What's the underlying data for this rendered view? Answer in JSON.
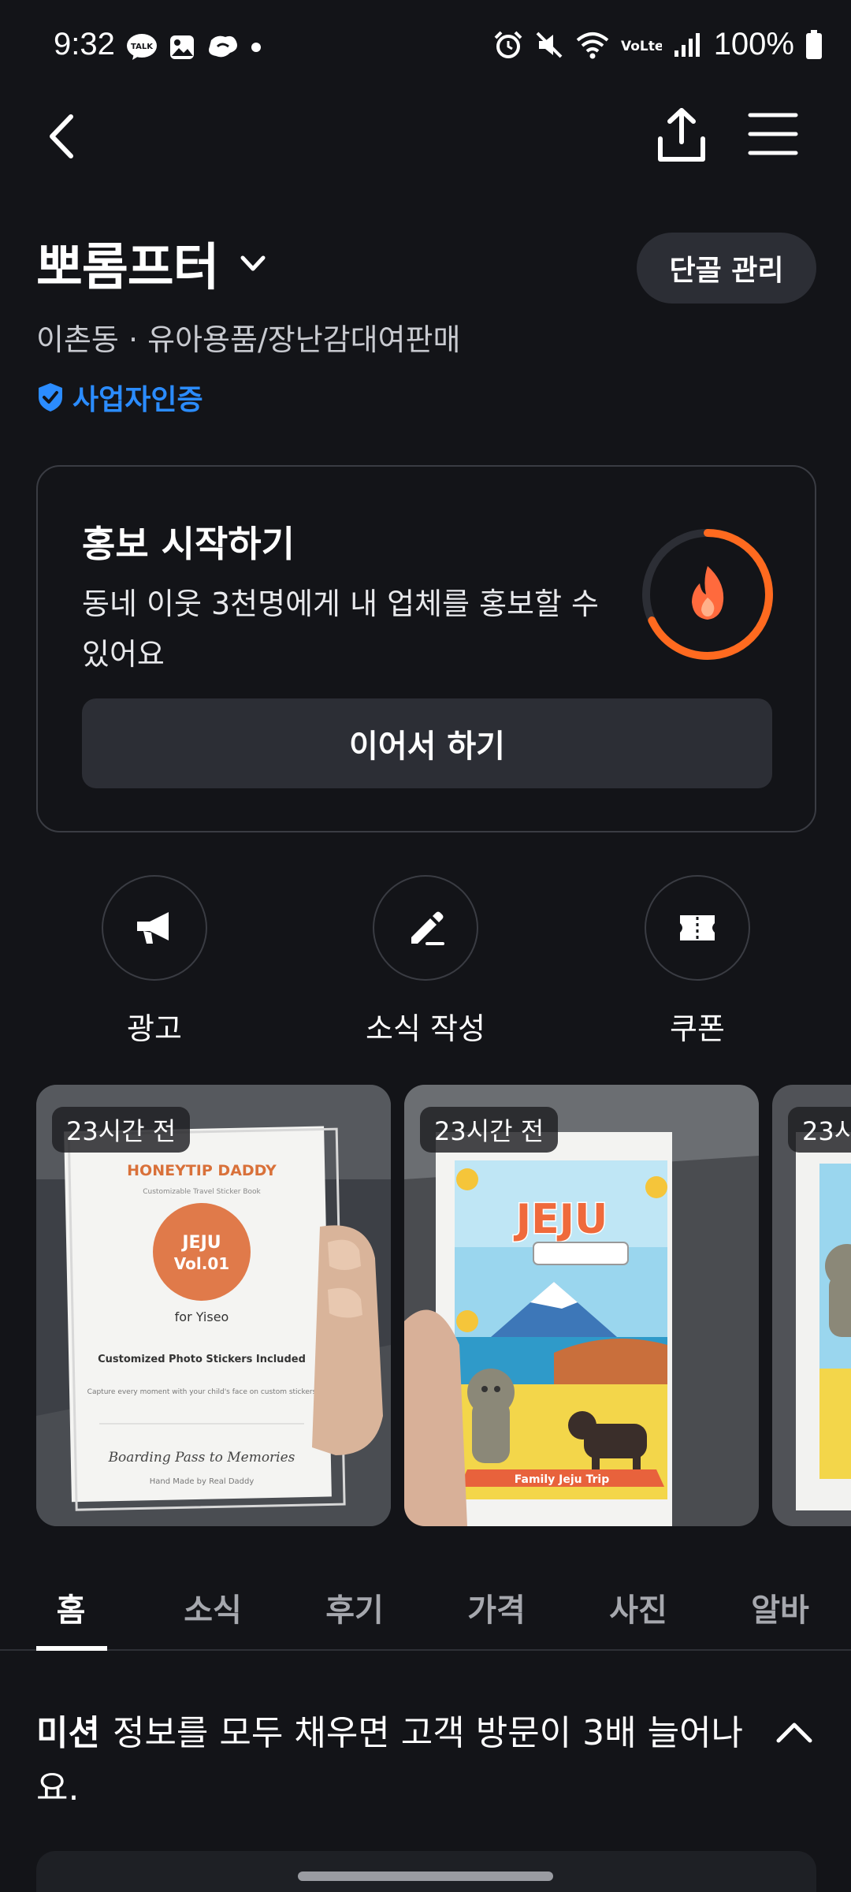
{
  "status_bar": {
    "time": "9:32",
    "left_icons": [
      "talk-icon",
      "gallery-icon",
      "chat-bubble-icon",
      "dot-icon"
    ],
    "talk_badge": "TALK",
    "right_icons": [
      "alarm-icon",
      "mute-icon",
      "wifi-icon",
      "volte-icon",
      "signal-icon",
      "battery-icon"
    ],
    "volte_text": "VoLte",
    "battery": "100%"
  },
  "nav": {
    "icons": [
      "back-icon",
      "share-icon",
      "menu-icon"
    ]
  },
  "store": {
    "name": "뽀롬프터",
    "meta": "이촌동 · 유아용품/장난감대여판매",
    "verified_label": "사업자인증",
    "regular_button": "단골 관리"
  },
  "promo": {
    "title": "홍보 시작하기",
    "description": "동네 이웃 3천명에게 내 업체를 홍보할 수 있어요",
    "button": "이어서 하기",
    "progress": 0.68,
    "accent": "#ff6a1f"
  },
  "actions": [
    {
      "label": "광고",
      "icon": "megaphone-icon"
    },
    {
      "label": "소식 작성",
      "icon": "pencil-icon"
    },
    {
      "label": "쿠폰",
      "icon": "ticket-icon"
    }
  ],
  "photos": [
    {
      "badge": "23시간 전",
      "subject": "HONEYTIP DADDY sticker book"
    },
    {
      "badge": "23시간 전",
      "subject": "JEJU sticker book"
    },
    {
      "badge": "23시"
    }
  ],
  "photo1": {
    "brand": "HONEYTIP DADDY",
    "tagline": "Customizable Travel Sticker Book",
    "badge_title": "JEJU",
    "badge_sub": "Vol.01",
    "for": "for Yiseo",
    "feature": "Customized Photo Stickers Included",
    "desc": "Capture every moment with your child's face on custom stickers",
    "slogan": "Boarding Pass to Memories",
    "maker": "Hand Made by Real Daddy"
  },
  "photo2": {
    "title": "JEJU",
    "banner": "Family Jeju Trip"
  },
  "tabs": [
    "홈",
    "소식",
    "후기",
    "가격",
    "사진",
    "알바"
  ],
  "active_tab": 0,
  "mission": {
    "label": "미션",
    "text": "정보를 모두 채우면 고객 방문이 3배 늘어나요."
  }
}
